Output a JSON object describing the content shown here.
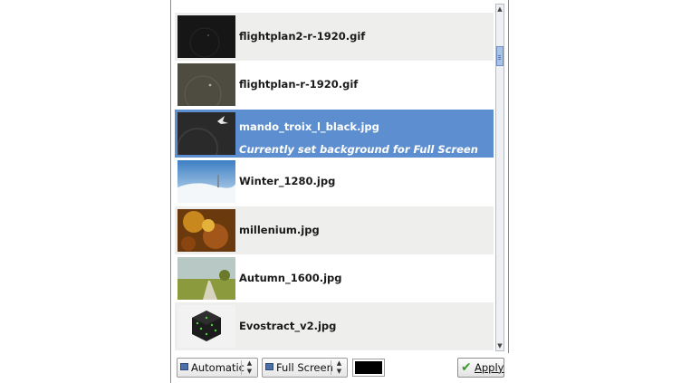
{
  "wallpapers": [
    {
      "name": "flightplan2-r-1920.gif",
      "selected": false
    },
    {
      "name": "flightplan-r-1920.gif",
      "selected": false
    },
    {
      "name": "mando_troix_l_black.jpg",
      "selected": true,
      "subtext": "Currently set background for Full Screen"
    },
    {
      "name": "Winter_1280.jpg",
      "selected": false
    },
    {
      "name": "millenium.jpg",
      "selected": false
    },
    {
      "name": "Autumn_1600.jpg",
      "selected": false
    },
    {
      "name": "Evostract_v2.jpg",
      "selected": false
    }
  ],
  "toolbar": {
    "mode_value": "Automatic",
    "target_value": "Full Screen",
    "background_color": "#000000",
    "apply_label": "Apply"
  },
  "colors": {
    "selection": "#5d8fd0",
    "alt_row": "#eeeeec"
  }
}
